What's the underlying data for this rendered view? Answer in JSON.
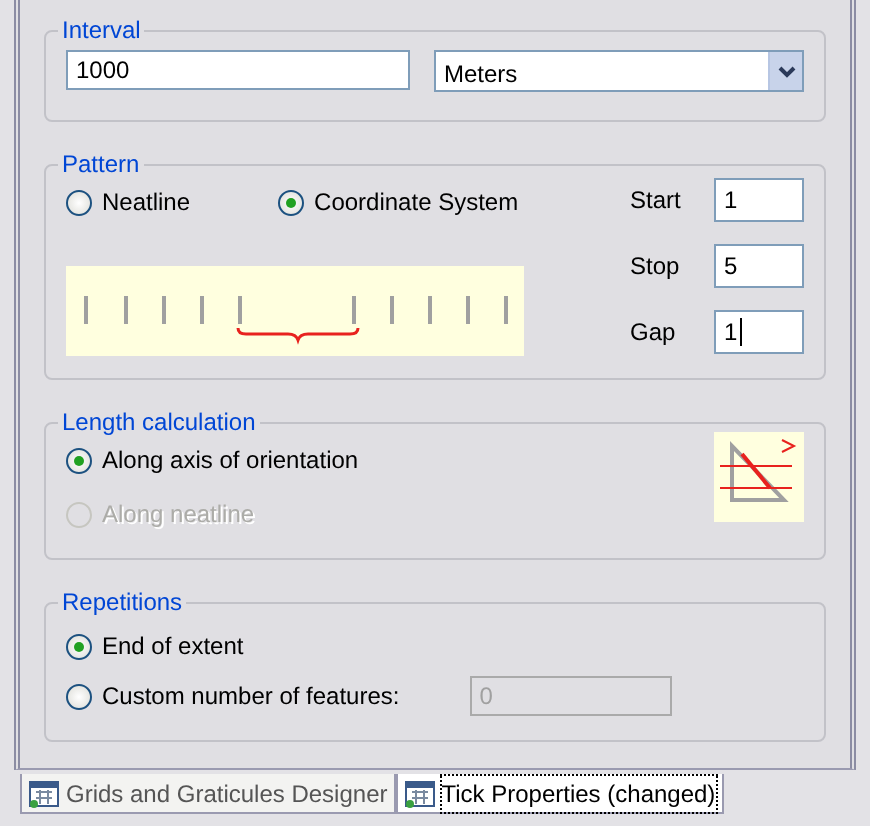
{
  "interval": {
    "title": "Interval",
    "value": "1000",
    "unit": "Meters"
  },
  "pattern": {
    "title": "Pattern",
    "options": [
      {
        "label": "Neatline",
        "selected": false
      },
      {
        "label": "Coordinate System",
        "selected": true
      }
    ],
    "fields": [
      {
        "label": "Start",
        "value": "1",
        "focused": false
      },
      {
        "label": "Stop",
        "value": "5",
        "focused": false
      },
      {
        "label": "Gap",
        "value": "1",
        "focused": true
      }
    ]
  },
  "length_calculation": {
    "title": "Length calculation",
    "options": [
      {
        "label": "Along axis of orientation",
        "selected": true,
        "disabled": false
      },
      {
        "label": "Along neatline",
        "selected": false,
        "disabled": true
      }
    ]
  },
  "repetitions": {
    "title": "Repetitions",
    "options": [
      {
        "label": "End of extent",
        "selected": true
      },
      {
        "label": "Custom number of features:",
        "selected": false
      }
    ],
    "count": {
      "value": "0",
      "disabled": true
    }
  },
  "tabs": [
    {
      "label": "Grids and Graticules Designer",
      "selected": false
    },
    {
      "label": "Tick Properties (changed)",
      "selected": true
    }
  ]
}
